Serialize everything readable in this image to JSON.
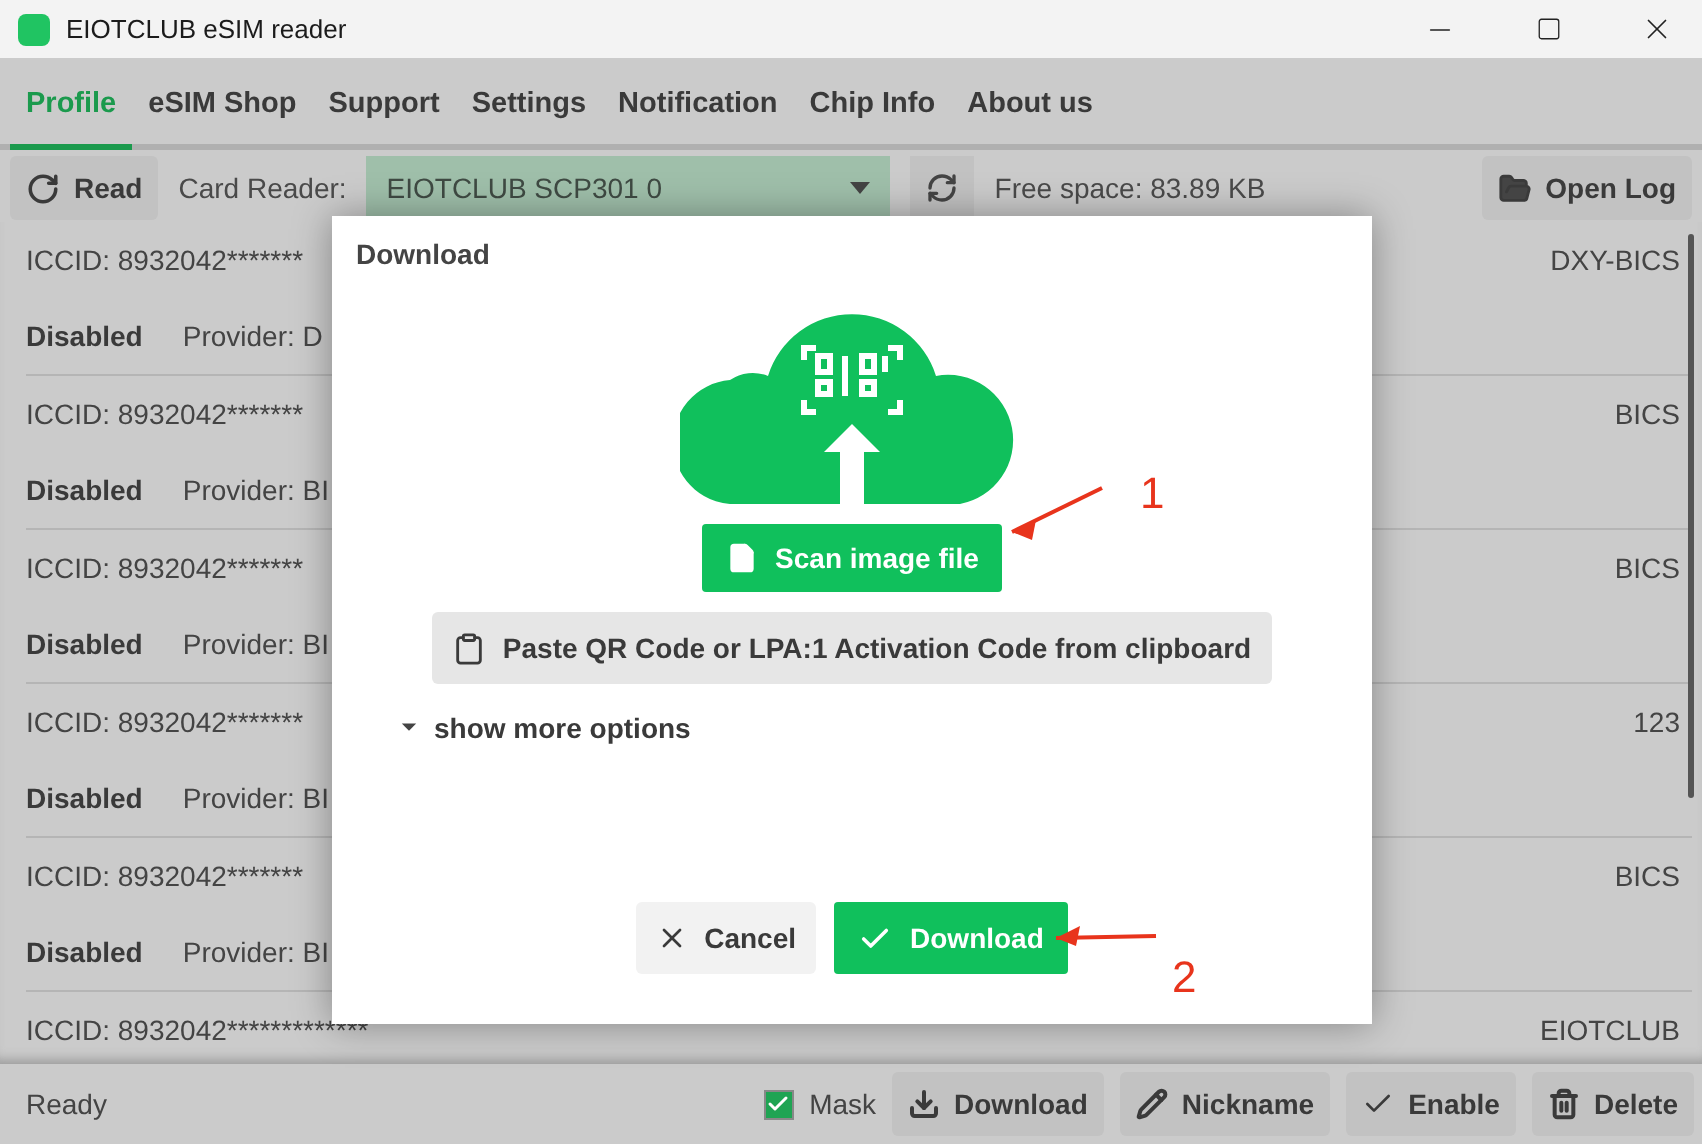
{
  "window": {
    "title": "EIOTCLUB eSIM reader"
  },
  "tabs": [
    {
      "label": "Profile",
      "selected": true
    },
    {
      "label": "eSIM Shop",
      "selected": false
    },
    {
      "label": "Support",
      "selected": false
    },
    {
      "label": "Settings",
      "selected": false
    },
    {
      "label": "Notification",
      "selected": false
    },
    {
      "label": "Chip Info",
      "selected": false
    },
    {
      "label": "About us",
      "selected": false
    }
  ],
  "toolbar": {
    "read_button": "Read",
    "card_reader_label": "Card Reader:",
    "card_reader_value": "EIOTCLUB SCP301 0",
    "free_space": "Free space: 83.89 KB",
    "open_log_button": "Open Log"
  },
  "profiles": [
    {
      "iccid": "ICCID: 8932042*******",
      "status": "Disabled",
      "provider": "Provider: D",
      "name": "DXY-BICS"
    },
    {
      "iccid": "ICCID: 8932042*******",
      "status": "Disabled",
      "provider": "Provider: BI",
      "name": "BICS"
    },
    {
      "iccid": "ICCID: 8932042*******",
      "status": "Disabled",
      "provider": "Provider: BI",
      "name": "BICS"
    },
    {
      "iccid": "ICCID: 8932042*******",
      "status": "Disabled",
      "provider": "Provider: BI",
      "name": "123"
    },
    {
      "iccid": "ICCID: 8932042*******",
      "status": "Disabled",
      "provider": "Provider: BI",
      "name": "BICS"
    },
    {
      "iccid": "ICCID: 8932042*************",
      "name": "EIOTCLUB"
    }
  ],
  "status_bar": {
    "text": "Ready",
    "mask": {
      "label": "Mask",
      "checked": true
    },
    "buttons": [
      {
        "kind": "download",
        "label": "Download"
      },
      {
        "kind": "nickname",
        "label": "Nickname"
      },
      {
        "kind": "enable",
        "label": "Enable"
      },
      {
        "kind": "delete",
        "label": "Delete"
      }
    ]
  },
  "dialog": {
    "title": "Download",
    "scan_button": "Scan image file",
    "paste_button": "Paste QR Code or LPA:1 Activation Code from clipboard",
    "more_options": {
      "label": "show more options",
      "expanded": false
    },
    "cancel_button": "Cancel",
    "confirm_button": "Download"
  },
  "annotations": [
    {
      "label": "1"
    },
    {
      "label": "2"
    }
  ]
}
